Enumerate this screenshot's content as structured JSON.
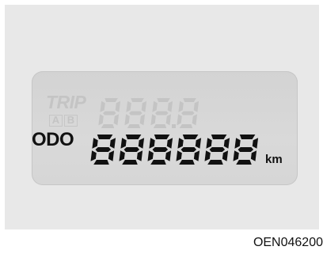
{
  "display": {
    "trip_label": "TRIP",
    "trip_ab_a": "A",
    "trip_ab_b": "B",
    "trip_digits": "888.8",
    "odo_label": "ODO",
    "odo_digits": "888888",
    "unit": "km"
  },
  "caption": "OEN046200",
  "colors": {
    "active_segment": "#111111",
    "inactive_segment": "#c4c4c4",
    "lcd_background": "#d6d6d6",
    "panel_background": "#e8e8e8"
  }
}
